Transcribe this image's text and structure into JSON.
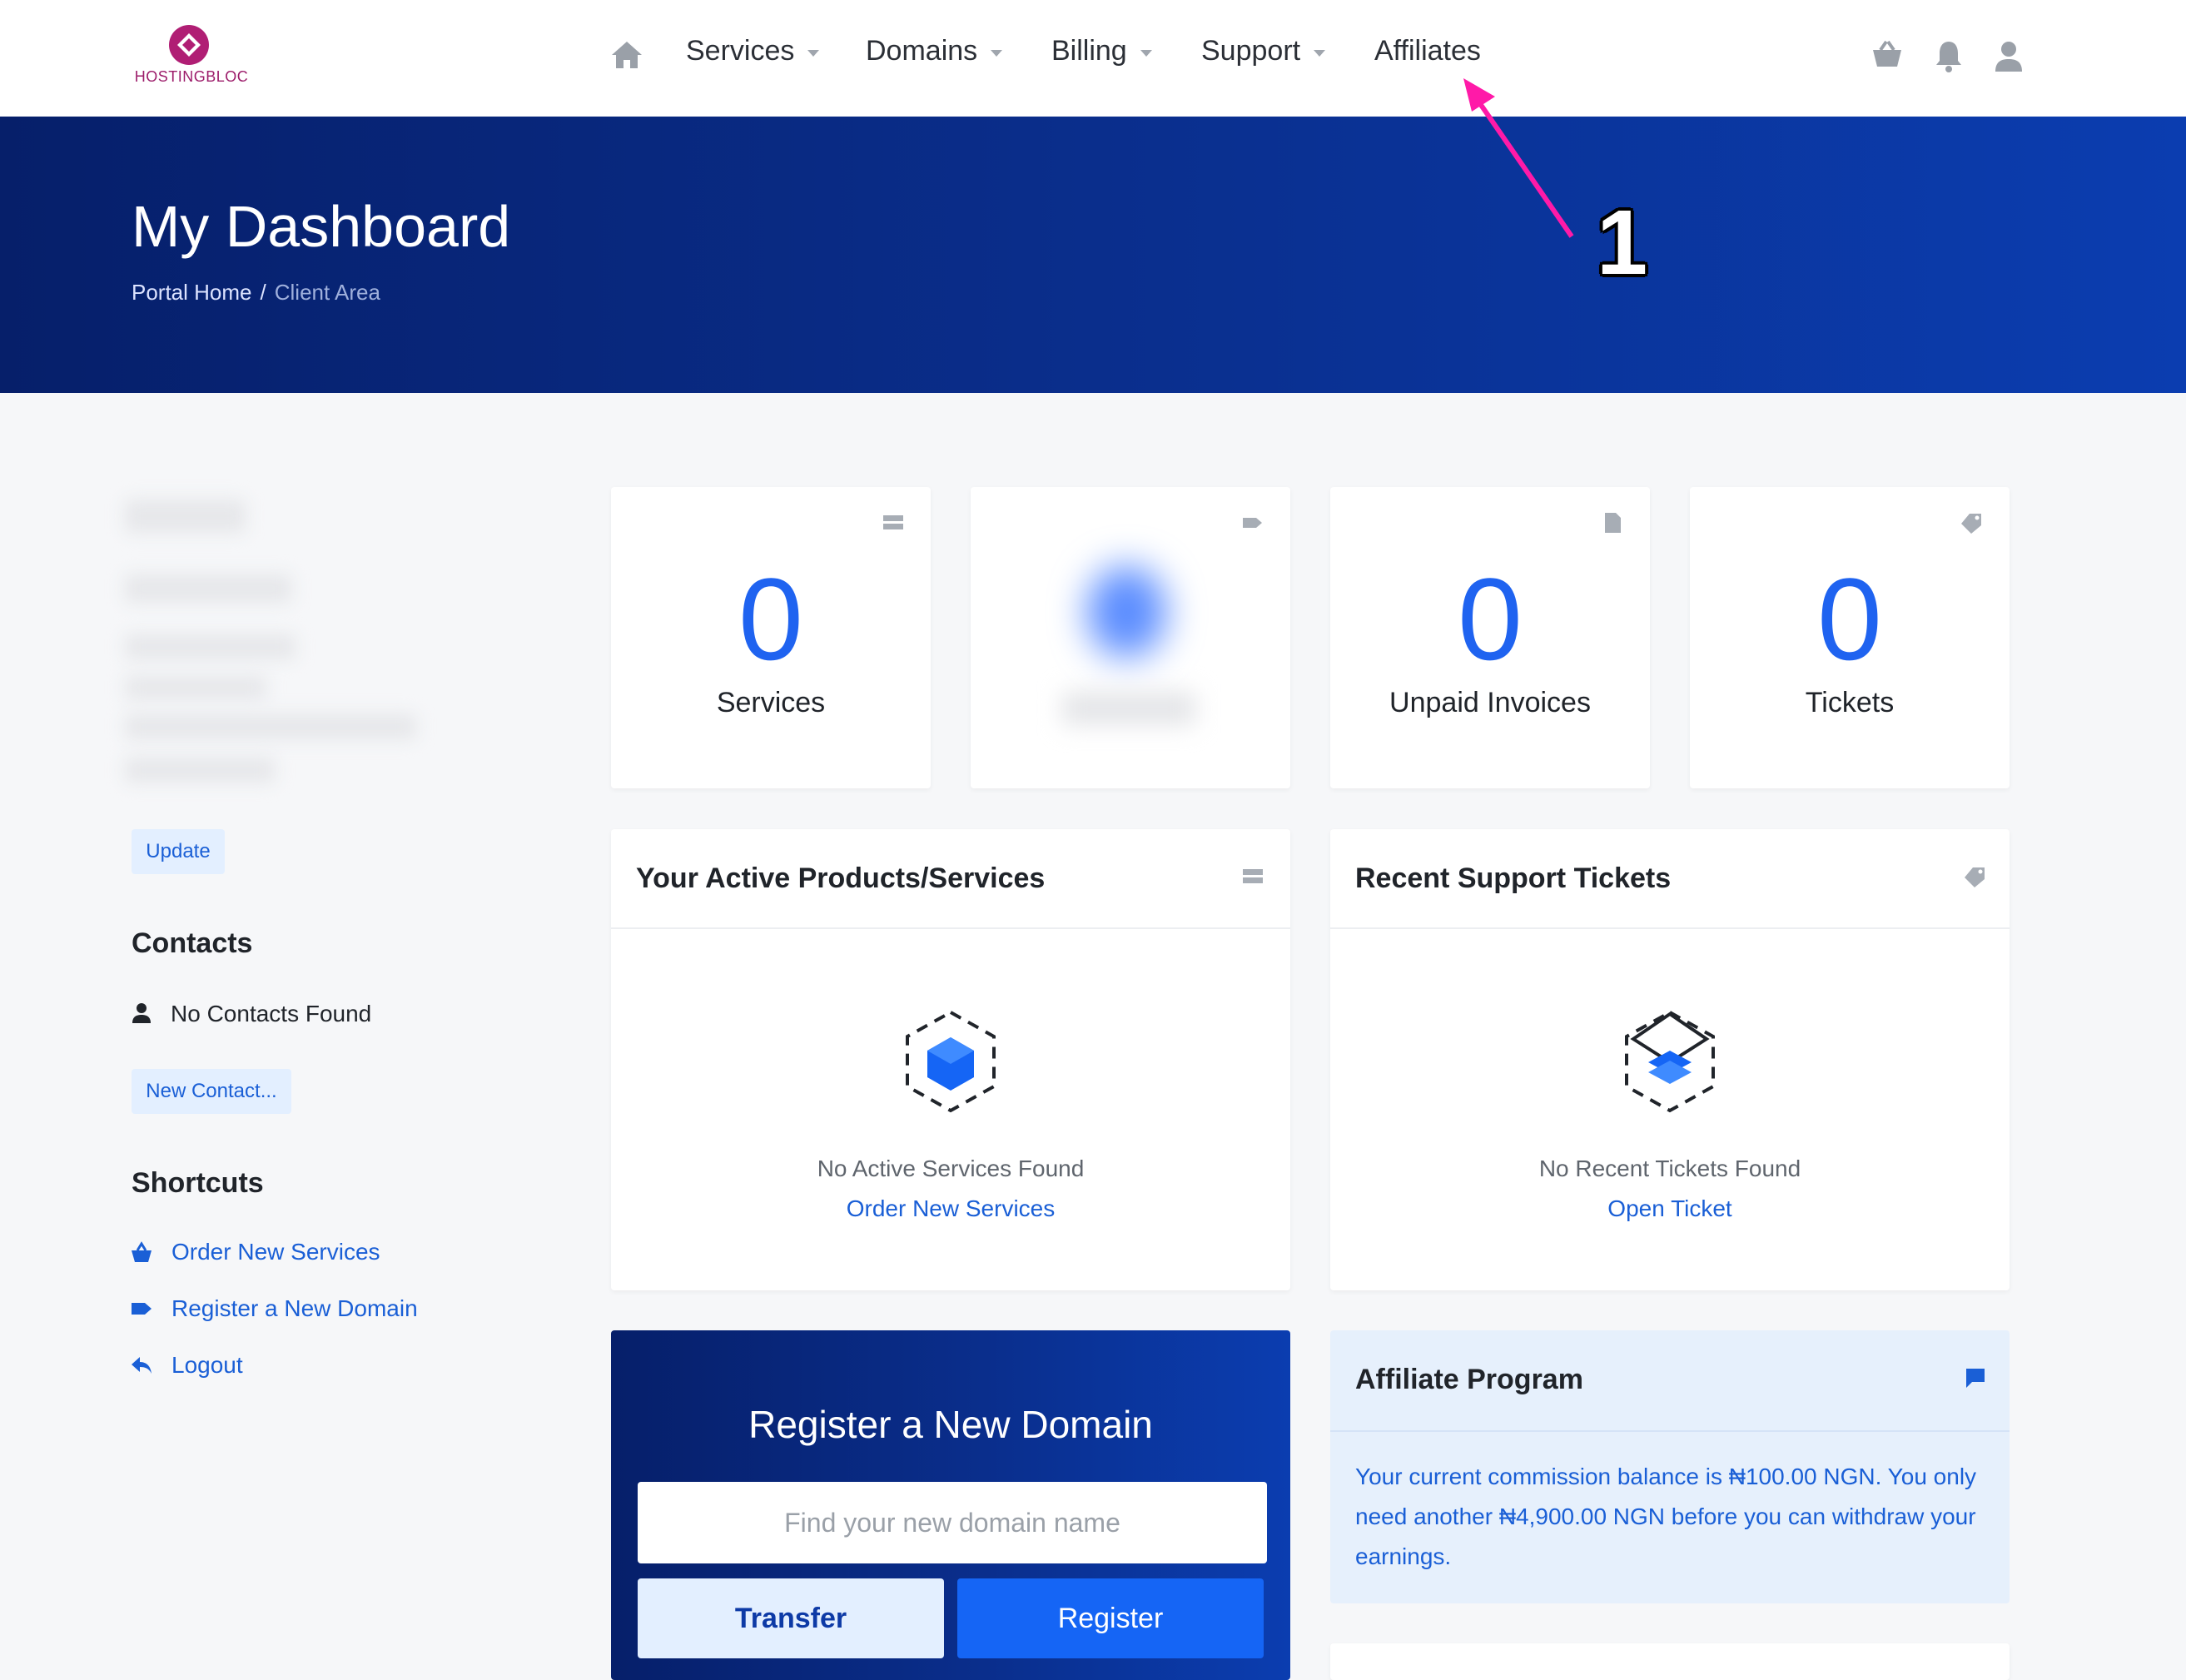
{
  "brand": {
    "name": "HOSTINGBLOC",
    "color": "#9c1c6a"
  },
  "navbar": {
    "items": [
      {
        "label": "Services",
        "has_caret": true
      },
      {
        "label": "Domains",
        "has_caret": true
      },
      {
        "label": "Billing",
        "has_caret": true
      },
      {
        "label": "Support",
        "has_caret": true
      },
      {
        "label": "Affiliates",
        "has_caret": false
      }
    ],
    "right_icons": [
      "cart-icon",
      "bell-icon",
      "user-icon"
    ]
  },
  "hero": {
    "title": "My Dashboard",
    "breadcrumb": {
      "home": "Portal Home",
      "separator": "/",
      "current": "Client Area"
    }
  },
  "annotation": {
    "number": "1",
    "color": "#ff1aa8"
  },
  "sidebar": {
    "update_label": "Update",
    "contacts": {
      "heading": "Contacts",
      "empty_text": "No Contacts Found",
      "new_contact_label": "New Contact..."
    },
    "shortcuts": {
      "heading": "Shortcuts",
      "items": [
        {
          "label": "Order New Services",
          "icon": "basket-icon"
        },
        {
          "label": "Register a New Domain",
          "icon": "tag-icon"
        },
        {
          "label": "Logout",
          "icon": "reply-icon"
        }
      ]
    }
  },
  "stats": {
    "services": {
      "value": "0",
      "label": "Services"
    },
    "invoices": {
      "value": "0",
      "label": "Unpaid Invoices"
    },
    "tickets": {
      "value": "0",
      "label": "Tickets"
    }
  },
  "panels": {
    "products": {
      "title": "Your Active Products/Services",
      "empty_text": "No Active Services Found",
      "link_label": "Order New Services"
    },
    "support": {
      "title": "Recent Support Tickets",
      "empty_text": "No Recent Tickets Found",
      "link_label": "Open Ticket"
    }
  },
  "domain": {
    "title": "Register a New Domain",
    "placeholder": "Find your new domain name",
    "transfer_label": "Transfer",
    "register_label": "Register"
  },
  "affiliate": {
    "title": "Affiliate Program",
    "text": "Your current commission balance is ₦100.00 NGN. You only need another ₦4,900.00 NGN before you can withdraw your earnings."
  },
  "colors": {
    "accent": "#1f63f0",
    "hero_dark": "#061f6a",
    "hero_light": "#0b3db0",
    "link": "#1a5fd6"
  }
}
